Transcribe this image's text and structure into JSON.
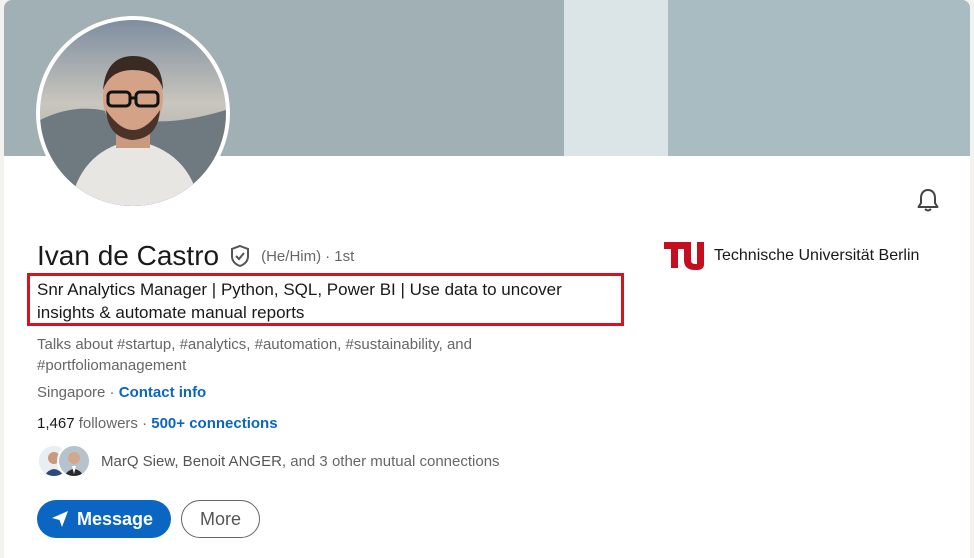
{
  "profile": {
    "name": "Ivan de Castro",
    "pronouns": "(He/Him)",
    "degree": "· 1st",
    "headline": "Snr Analytics Manager | Python, SQL, Power BI | Use data to uncover insights & automate manual reports",
    "talks_about": "Talks about #startup, #analytics, #automation, #sustainability, and #portfoliomanagement",
    "location": "Singapore",
    "location_sep": " · ",
    "contact_info": "Contact info",
    "followers_count": "1,467",
    "followers_label": " followers",
    "followers_sep": " · ",
    "connections": "500+ connections",
    "mutual_names": "MarQ Siew, Benoit ANGER",
    "mutual_rest": ", and 3 other mutual connections"
  },
  "education": {
    "school_name": "Technische Universität Berlin"
  },
  "actions": {
    "message_label": "Message",
    "more_label": "More"
  },
  "icons": {
    "verified": "verified-shield-icon",
    "bell": "bell-icon",
    "send": "send-icon"
  },
  "colors": {
    "accent": "#0a66c2",
    "highlight_box": "#d4151f",
    "school_logo": "#c50e1f"
  }
}
